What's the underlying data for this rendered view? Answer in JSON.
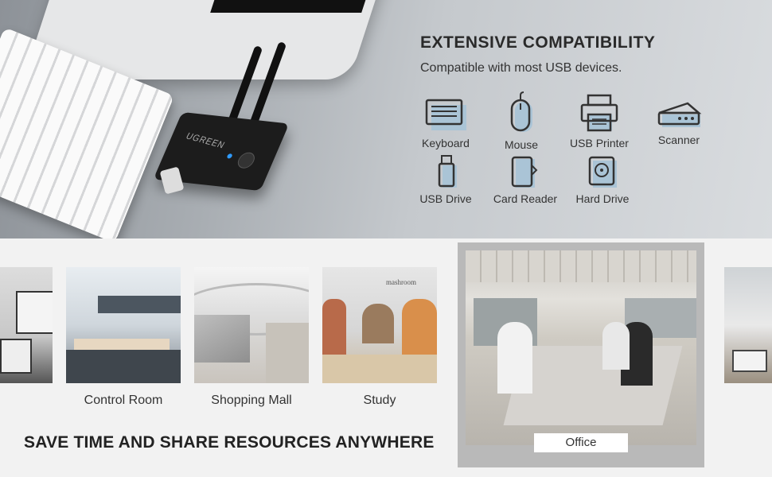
{
  "compatibility": {
    "title": "EXTENSIVE COMPATIBILITY",
    "subtitle": "Compatible with most USB devices.",
    "devices": [
      {
        "label": "Keyboard",
        "icon": "keyboard-icon"
      },
      {
        "label": "Mouse",
        "icon": "mouse-icon"
      },
      {
        "label": "USB Printer",
        "icon": "printer-icon"
      },
      {
        "label": "Scanner",
        "icon": "scanner-icon"
      },
      {
        "label": "USB Drive",
        "icon": "usb-drive-icon"
      },
      {
        "label": "Card Reader",
        "icon": "card-reader-icon"
      },
      {
        "label": "Hard Drive",
        "icon": "hard-drive-icon"
      }
    ]
  },
  "product": {
    "brand": "UGREEN"
  },
  "scenes": [
    {
      "label": ""
    },
    {
      "label": "Control Room"
    },
    {
      "label": "Shopping Mall"
    },
    {
      "label": "Study"
    },
    {
      "label": "Office"
    },
    {
      "label": ""
    }
  ],
  "study_wall_text": "mashroom",
  "tagline": "SAVE TIME AND SHARE RESOURCES ANYWHERE",
  "colors": {
    "icon_accent": "#aac4d6",
    "icon_stroke": "#333333",
    "hero_bg": "#c5c9cd",
    "page_bg": "#f2f2f2"
  }
}
